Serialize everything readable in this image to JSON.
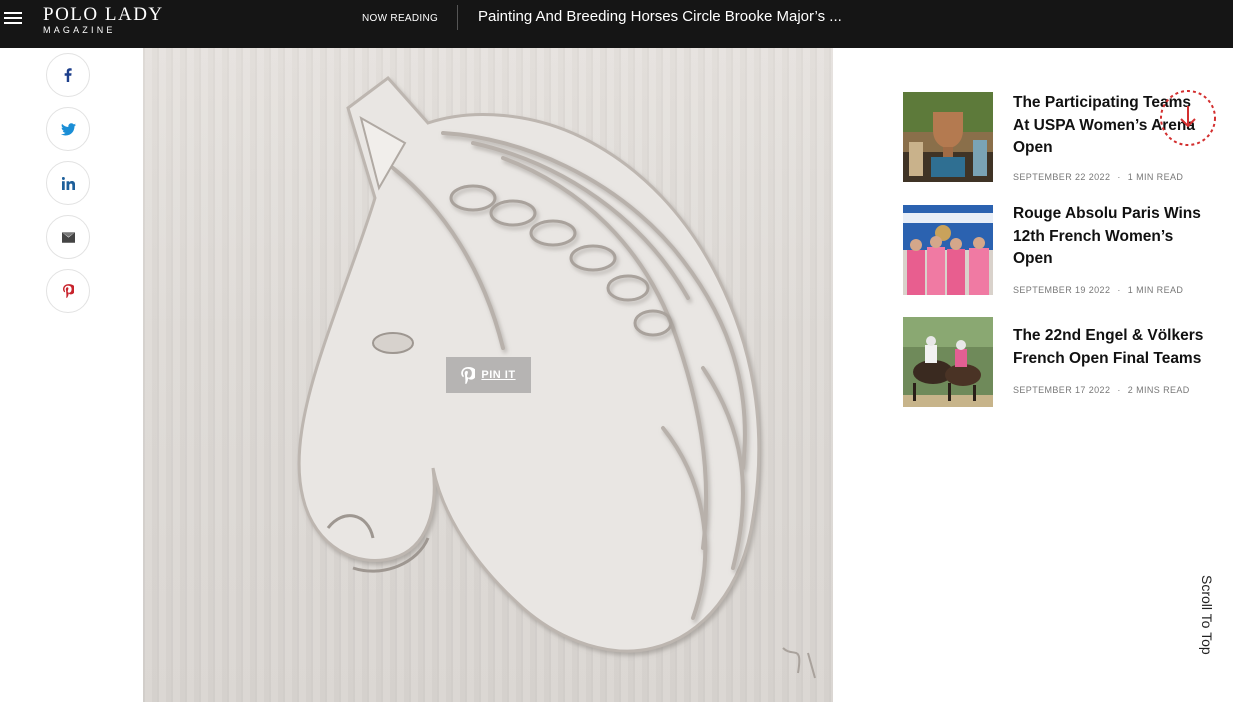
{
  "header": {
    "logo_main": "POLO LADY",
    "logo_sub": "MAGAZINE",
    "now_reading_label": "NOW READING",
    "reading_title": "Painting And Breeding Horses Circle Brooke Major’s ..."
  },
  "share": {
    "icons": [
      "facebook-icon",
      "twitter-icon",
      "linkedin-icon",
      "email-icon",
      "pinterest-icon"
    ]
  },
  "hero": {
    "pin_label": "PIN IT"
  },
  "posts": [
    {
      "title": "The Participating Teams At USPA Women’s Arena Open",
      "date": "SEPTEMBER 22 2022",
      "read_time": "1 MIN READ"
    },
    {
      "title": "Rouge Absolu Paris Wins 12th French Women’s Open",
      "date": "SEPTEMBER 19 2022",
      "read_time": "1 MIN READ"
    },
    {
      "title": "The 22nd Engel & Völkers French Open Final Teams",
      "date": "SEPTEMBER 17 2022",
      "read_time": "2 MINS READ"
    }
  ],
  "scroll_top_label": "Scroll To Top",
  "colors": {
    "header_bg": "#151515",
    "accent": "#d32f2f"
  }
}
